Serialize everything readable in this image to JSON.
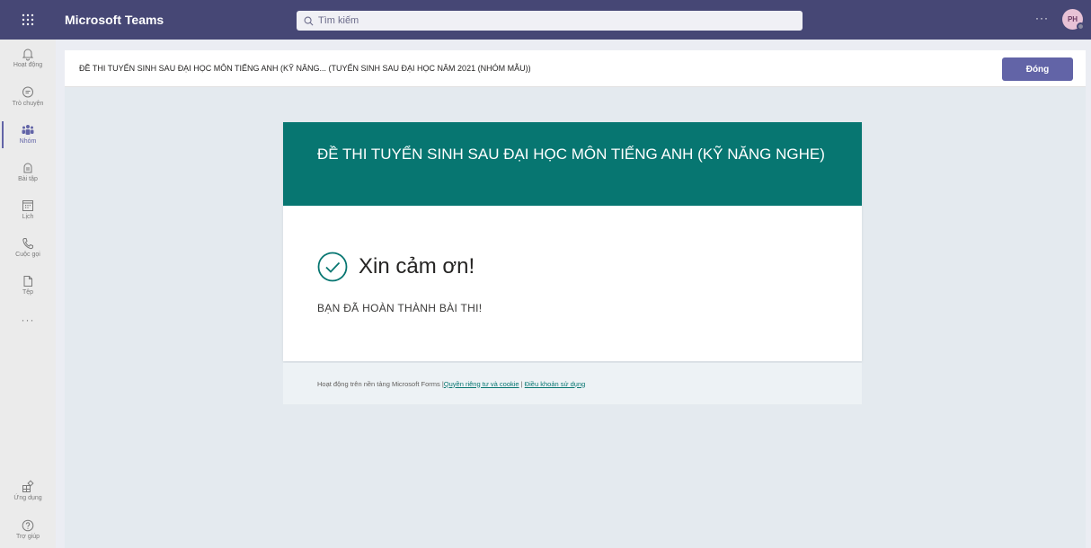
{
  "topbar": {
    "app_name": "Microsoft Teams",
    "search_placeholder": "Tìm kiếm",
    "more_label": "···",
    "avatar_initials": "PH",
    "color": "#464775"
  },
  "rail": {
    "items": [
      {
        "label": "Hoạt động",
        "icon": "bell-icon"
      },
      {
        "label": "Trò chuyện",
        "icon": "chat-icon"
      },
      {
        "label": "Nhóm",
        "icon": "teams-icon",
        "active": true
      },
      {
        "label": "Bài tập",
        "icon": "assignments-icon"
      },
      {
        "label": "Lịch",
        "icon": "calendar-icon"
      },
      {
        "label": "Cuộc gọi",
        "icon": "phone-icon"
      },
      {
        "label": "Tệp",
        "icon": "file-icon"
      }
    ],
    "more_label": "···",
    "bottom_items": [
      {
        "label": "Ứng dụng",
        "icon": "apps-icon"
      },
      {
        "label": "Trợ giúp",
        "icon": "help-icon"
      }
    ]
  },
  "header": {
    "title": "ĐỀ THI TUYỂN SINH SAU ĐẠI HỌC MÔN TIẾNG ANH (KỸ NĂNG... (TUYỂN SINH SAU ĐẠI HỌC NĂM 2021 (NHÓM MẪU))",
    "close_label": "Đóng",
    "accent": "#6264a7"
  },
  "form": {
    "title": "ĐỀ THI TUYỂN SINH SAU ĐẠI HỌC MÔN TIẾNG ANH (KỸ NĂNG NGHE)",
    "thanks": "Xin cảm ơn!",
    "message": "BẠN ĐÃ HOÀN THÀNH BÀI THI!",
    "color": "#077671"
  },
  "footer": {
    "prefix": "Hoạt động trên nền tảng Microsoft Forms | ",
    "privacy_link": "Quyền riêng tư và cookie",
    "separator": " | ",
    "terms_link": "Điều khoản sử dụng"
  }
}
